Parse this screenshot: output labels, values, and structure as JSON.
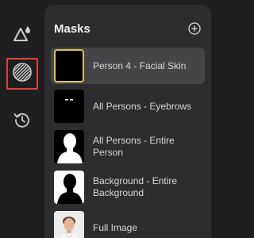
{
  "panel": {
    "title": "Masks"
  },
  "toolbar": {
    "tools": [
      {
        "icon": "triangle-drop-icon"
      },
      {
        "icon": "mask-circle-icon",
        "active": true
      },
      {
        "icon": "history-icon"
      }
    ]
  },
  "masks": [
    {
      "label": "Person 4 - Facial Skin",
      "thumb": "black",
      "selected": true
    },
    {
      "label": "All Persons - Eyebrows",
      "thumb": "eyebrows"
    },
    {
      "label": "All Persons - Entire Person",
      "thumb": "silhouette"
    },
    {
      "label": "Background - Entire Background",
      "thumb": "inverse-silhouette"
    },
    {
      "label": "Full Image",
      "thumb": "photo"
    }
  ],
  "colors": {
    "active_outline": "#e0413a",
    "selected_thumb_border": "#d9c45a",
    "panel_bg": "#2d2d30",
    "selected_row_bg": "#454548"
  }
}
